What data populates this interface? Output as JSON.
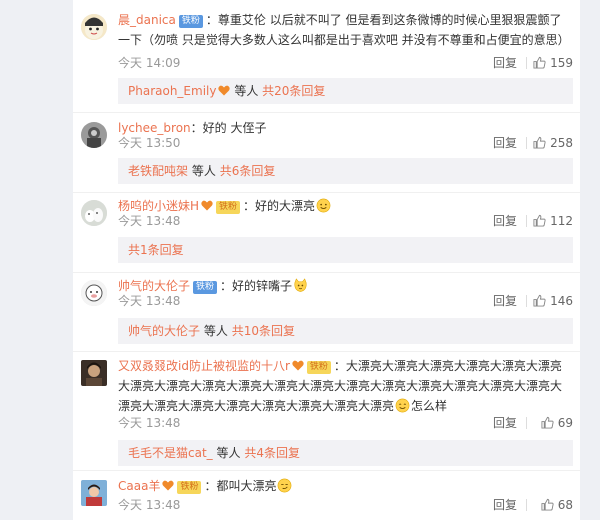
{
  "comments": [
    {
      "username": "晨_danica",
      "badge": "铁粉",
      "text": "：尊重艾伦 以后就不叫了 但是看到这条微博的时候心里狠狠震颤了一下（勿喷 只是觉得大多数人这么叫都是出于喜欢吧 并没有不尊重和占便宜的意思）",
      "time": "今天 14:09",
      "reply_label": "回复",
      "likes": "159",
      "replies_user": "Pharaoh_Emily",
      "replies_suffix": "等人",
      "replies_count": "共20条回复"
    },
    {
      "username": "lychee_bron",
      "text": "：好的 大侄子",
      "time": "今天 13:50",
      "reply_label": "回复",
      "likes": "258",
      "replies_user": "老铁配吨架",
      "replies_suffix": "等人",
      "replies_count": "共6条回复"
    },
    {
      "username": "杨呜的小迷妹H",
      "badge": "铁粉",
      "text": "：好的大漂亮",
      "time": "今天 13:48",
      "reply_label": "回复",
      "likes": "112",
      "replies_count": "共1条回复"
    },
    {
      "username": "帅气的大伦子",
      "badge": "铁粉",
      "text": "：好的锌嘴子",
      "time": "今天 13:48",
      "reply_label": "回复",
      "likes": "146",
      "replies_user": "帅气的大伦子",
      "replies_suffix": "等人",
      "replies_count": "共10条回复"
    },
    {
      "username": "又双叒叕改id防止被视监的十八r",
      "badge": "铁粉",
      "text": "：大漂亮大漂亮大漂亮大漂亮大漂亮大漂亮大漂亮大漂亮大漂亮大漂亮大漂亮大漂亮大漂亮大漂亮大漂亮大漂亮大漂亮大漂亮大漂亮大漂亮大漂亮大漂亮大漂亮大漂亮大漂亮大漂亮",
      "text_tail": "怎么样",
      "time": "今天 13:48",
      "reply_label": "回复",
      "likes": "69",
      "replies_user": "毛毛不是猫cat_",
      "replies_suffix": "等人",
      "replies_count": "共4条回复"
    },
    {
      "username": "Caaa羊",
      "badge": "铁粉",
      "text": "：都叫大漂亮",
      "time": "今天 13:48",
      "reply_label": "回复",
      "likes": "68"
    }
  ],
  "colors": {
    "username": "#eb7350",
    "fan_badge": "#5a98e0",
    "iron_badge": "#f6d65a",
    "reply_bg": "#f2f2f5"
  }
}
